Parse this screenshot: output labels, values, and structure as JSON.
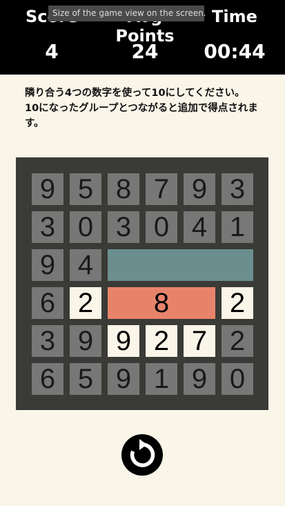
{
  "header": {
    "score_label": "Score",
    "average_label": "Avg Points",
    "time_label": "Time",
    "score_value": "4",
    "average_value": "24",
    "time_value": "00:44"
  },
  "tooltip": "Size of the game view on the screen.",
  "instructions": {
    "line1": "隣り合う4つの数字を使って10にしてください。",
    "line2": "10になったグループとつながると追加で得点されます。"
  },
  "board": {
    "rows": [
      [
        "9",
        "5",
        "8",
        "7",
        "9",
        "3"
      ],
      [
        "3",
        "0",
        "3",
        "0",
        "4",
        "1"
      ],
      [
        "9",
        "4",
        "",
        "",
        "",
        ""
      ],
      [
        "6",
        "2",
        "",
        "",
        "",
        "2"
      ],
      [
        "3",
        "9",
        "9",
        "2",
        "7",
        "2"
      ],
      [
        "6",
        "5",
        "9",
        "1",
        "9",
        "0"
      ]
    ],
    "merged_teal_value": "",
    "merged_red_value": "8",
    "colors": {
      "cell": "#777777",
      "highlight": "#f9f5e8",
      "teal_group": "#6b8e8e",
      "red_group": "#e8836b",
      "board_bg": "#3a3a36"
    }
  },
  "reset_icon": "restart-icon"
}
